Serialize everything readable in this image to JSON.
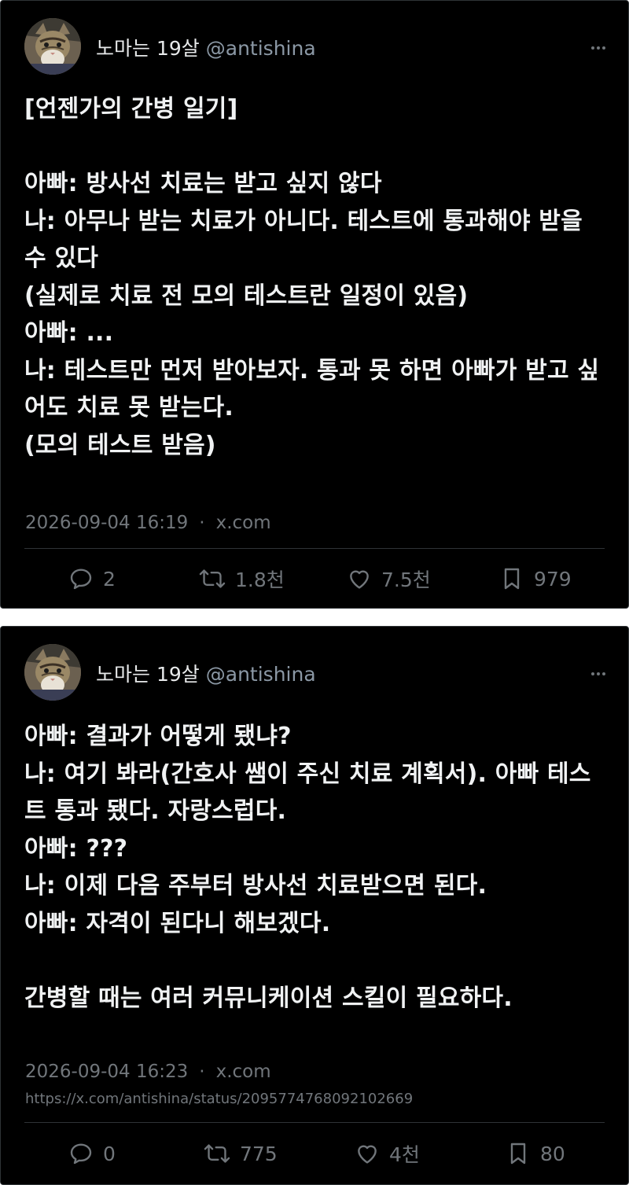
{
  "tweets": [
    {
      "display_name": "노마는 19살",
      "handle": "@antishina",
      "lines": [
        "[언젠가의 간병 일기]",
        "",
        "아빠: 방사선 치료는 받고 싶지 않다",
        "나: 아무나 받는 치료가 아니다. 테스트에 통과해야 받을 수 있다",
        "(실제로 치료 전 모의 테스트란 일정이 있음)",
        "아빠: ...",
        "나: 테스트만 먼저 받아보자. 통과 못 하면 아빠가 받고 싶어도 치료 못 받는다.",
        "(모의 테스트 받음)"
      ],
      "timestamp": "2026-09-04 16:19",
      "source": "x.com",
      "stats": {
        "replies": "2",
        "reposts": "1.8천",
        "likes": "7.5천",
        "bookmarks": "979"
      }
    },
    {
      "display_name": "노마는 19살",
      "handle": "@antishina",
      "lines": [
        "아빠: 결과가 어떻게 됐냐?",
        "나: 여기 봐라(간호사 쌤이 주신 치료 계획서). 아빠 테스트 통과 됐다. 자랑스럽다.",
        "아빠: ???",
        "나: 이제 다음 주부터 방사선 치료받으면 된다.",
        "아빠: 자격이 된다니 해보겠다.",
        "",
        "간병할 때는 여러 커뮤니케이션 스킬이 필요하다."
      ],
      "timestamp": "2026-09-04 16:23",
      "source": "x.com",
      "url": "https://x.com/antishina/status/2095774768092102669",
      "stats": {
        "replies": "0",
        "reposts": "775",
        "likes": "4천",
        "bookmarks": "80"
      }
    }
  ],
  "colors": {
    "background": "#000000",
    "text": "#e7e9ea",
    "muted": "#71767b",
    "border": "#2f3336"
  },
  "icons": [
    "more-icon",
    "reply-icon",
    "repost-icon",
    "like-icon",
    "bookmark-icon"
  ]
}
